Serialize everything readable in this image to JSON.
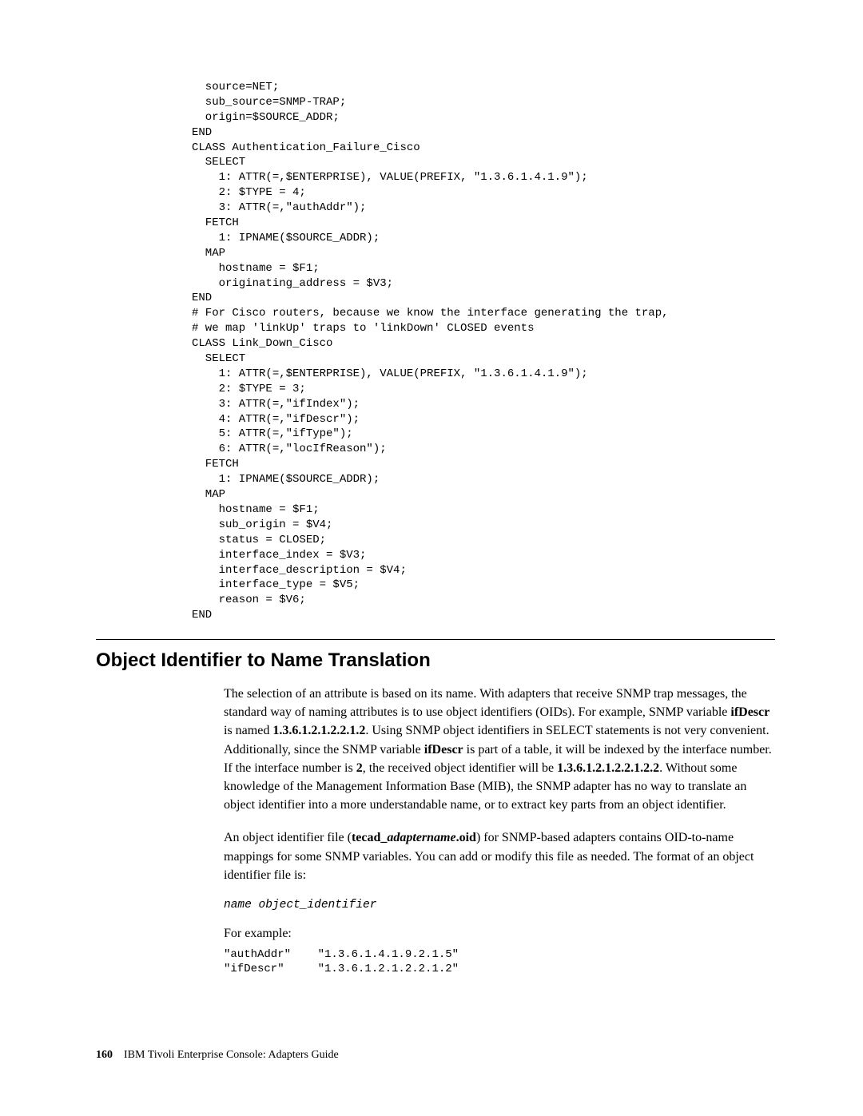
{
  "codeBlock": "  source=NET;\n  sub_source=SNMP-TRAP;\n  origin=$SOURCE_ADDR;\nEND\nCLASS Authentication_Failure_Cisco\n  SELECT\n    1: ATTR(=,$ENTERPRISE), VALUE(PREFIX, \"1.3.6.1.4.1.9\");\n    2: $TYPE = 4;\n    3: ATTR(=,\"authAddr\");\n  FETCH\n    1: IPNAME($SOURCE_ADDR);\n  MAP\n    hostname = $F1;\n    originating_address = $V3;\nEND\n# For Cisco routers, because we know the interface generating the trap,\n# we map 'linkUp' traps to 'linkDown' CLOSED events\nCLASS Link_Down_Cisco\n  SELECT\n    1: ATTR(=,$ENTERPRISE), VALUE(PREFIX, \"1.3.6.1.4.1.9\");\n    2: $TYPE = 3;\n    3: ATTR(=,\"ifIndex\");\n    4: ATTR(=,\"ifDescr\");\n    5: ATTR(=,\"ifType\");\n    6: ATTR(=,\"locIfReason\");\n  FETCH\n    1: IPNAME($SOURCE_ADDR);\n  MAP\n    hostname = $F1;\n    sub_origin = $V4;\n    status = CLOSED;\n    interface_index = $V3;\n    interface_description = $V4;\n    interface_type = $V5;\n    reason = $V6;\nEND",
  "sectionTitle": "Object Identifier to Name Translation",
  "para1": {
    "t1": "The selection of an attribute is based on its name. With adapters that receive SNMP trap messages, the standard way of naming attributes is to use object identifiers (OIDs). For example, SNMP variable ",
    "b1": "ifDescr",
    "t2": " is named ",
    "b2": "1.3.6.1.2.1.2.2.1.2",
    "t3": ". Using SNMP object identifiers in SELECT statements is not very convenient. Additionally, since the SNMP variable ",
    "b3": "ifDescr",
    "t4": " is part of a table, it will be indexed by the interface number. If the interface number is ",
    "b4": "2",
    "t5": ", the received object identifier will be ",
    "b5": "1.3.6.1.2.1.2.2.1.2.2",
    "t6": ". Without some knowledge of the Management Information Base (MIB), the SNMP adapter has no way to translate an object identifier into a more understandable name, or to extract key parts from an object identifier."
  },
  "para2": {
    "t1": "An object identifier file (",
    "b1": "tecad_",
    "bi1": "adaptername",
    "b2": ".oid",
    "t2": ") for SNMP-based adapters contains OID-to-name mappings for some SNMP variables. You can add or modify this file as needed. The format of an object identifier file is:"
  },
  "formatLine": "name object_identifier",
  "para3": "For example:",
  "exampleCode": "\"authAddr\"    \"1.3.6.1.4.1.9.2.1.5\"\n\"ifDescr\"     \"1.3.6.1.2.1.2.2.1.2\"",
  "footer": {
    "pageNum": "160",
    "bookTitle": "IBM Tivoli Enterprise Console: Adapters Guide"
  }
}
